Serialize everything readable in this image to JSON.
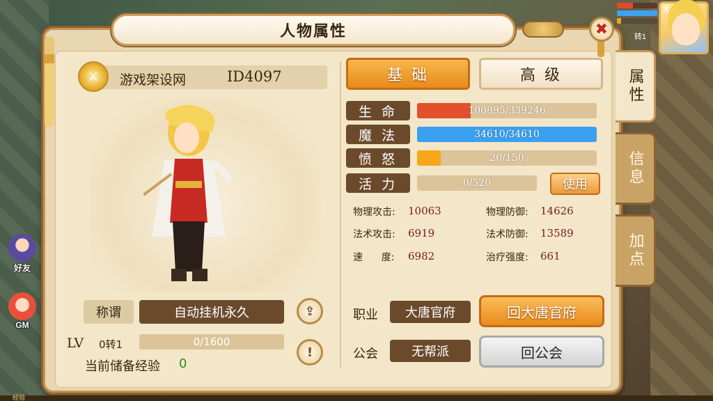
{
  "window": {
    "title": "人物属性"
  },
  "hud": {
    "portrait_tag": "大",
    "reborn_tag": "转1",
    "friend_label": "好友",
    "gm_label": "GM",
    "exp_label": "经验"
  },
  "player": {
    "name": "游戏架设网",
    "id": "ID4097",
    "title_label": "称谓",
    "title_value": "自动挂机永久",
    "lv_label": "LV",
    "reborn": "0转1",
    "exp": "0/1600",
    "exp_fraction": 0,
    "stored_exp_label": "当前储备经验",
    "stored_exp_value": "0"
  },
  "tabs": {
    "basic": "基 础",
    "advanced": "高 级"
  },
  "stats": {
    "hp": {
      "label": "生 命",
      "text": "100895/339246",
      "fraction": 0.297,
      "color": "#e2502e"
    },
    "mp": {
      "label": "魔 法",
      "text": "34610/34610",
      "fraction": 1.0,
      "color": "#3aa0f0"
    },
    "rage": {
      "label": "愤 怒",
      "text": "20/150",
      "fraction": 0.133,
      "color": "#f6a81a"
    },
    "vigor": {
      "label": "活 力",
      "text": "0/520",
      "fraction": 0
    },
    "use_button": "使用"
  },
  "attributes": [
    {
      "name": "物理攻击:",
      "value": "10063"
    },
    {
      "name": "物理防御:",
      "value": "14626"
    },
    {
      "name": "法术攻击:",
      "value": "6919"
    },
    {
      "name": "法术防御:",
      "value": "13589"
    },
    {
      "name": "速      度:",
      "value": "6982"
    },
    {
      "name": "治疗强度:",
      "value": "661"
    }
  ],
  "career": {
    "profession_label": "职业",
    "profession_value": "大唐官府",
    "return_school_button": "回大唐官府",
    "guild_label": "公会",
    "guild_value": "无帮派",
    "return_guild_button": "回公会"
  },
  "side_tabs": {
    "attributes": "属性",
    "info": "信息",
    "points": "加点"
  },
  "icons": {
    "close": "close-icon",
    "upload": "upload-icon",
    "info": "exclamation-icon",
    "emblem": "guild-emblem-icon"
  }
}
